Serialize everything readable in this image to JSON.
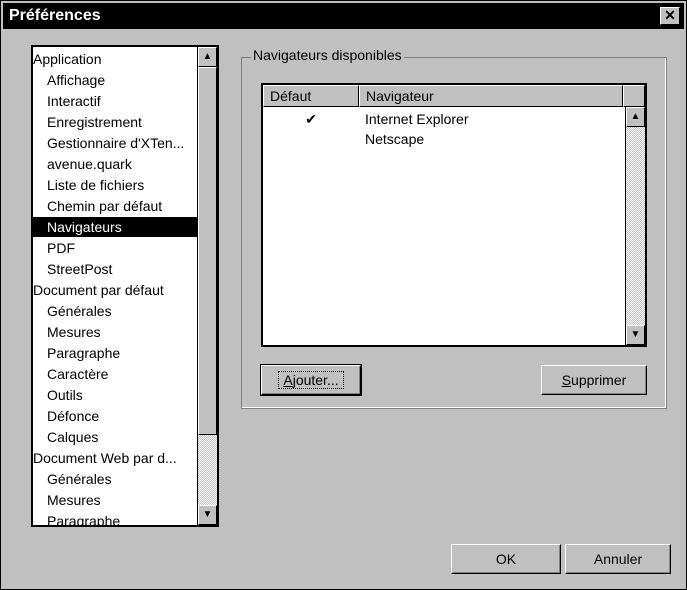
{
  "window": {
    "title": "Préférences"
  },
  "sidebar": {
    "items": [
      {
        "label": "Application",
        "level": 0,
        "selected": false
      },
      {
        "label": "Affichage",
        "level": 1,
        "selected": false
      },
      {
        "label": "Interactif",
        "level": 1,
        "selected": false
      },
      {
        "label": "Enregistrement",
        "level": 1,
        "selected": false
      },
      {
        "label": "Gestionnaire d'XTen...",
        "level": 1,
        "selected": false
      },
      {
        "label": "avenue.quark",
        "level": 1,
        "selected": false
      },
      {
        "label": "Liste de fichiers",
        "level": 1,
        "selected": false
      },
      {
        "label": "Chemin par défaut",
        "level": 1,
        "selected": false
      },
      {
        "label": "Navigateurs",
        "level": 1,
        "selected": true
      },
      {
        "label": "PDF",
        "level": 1,
        "selected": false
      },
      {
        "label": "StreetPost",
        "level": 1,
        "selected": false
      },
      {
        "label": "Document par défaut",
        "level": 0,
        "selected": false
      },
      {
        "label": "Générales",
        "level": 1,
        "selected": false
      },
      {
        "label": "Mesures",
        "level": 1,
        "selected": false
      },
      {
        "label": "Paragraphe",
        "level": 1,
        "selected": false
      },
      {
        "label": "Caractère",
        "level": 1,
        "selected": false
      },
      {
        "label": "Outils",
        "level": 1,
        "selected": false
      },
      {
        "label": "Défonce",
        "level": 1,
        "selected": false
      },
      {
        "label": "Calques",
        "level": 1,
        "selected": false
      },
      {
        "label": "Document Web par d...",
        "level": 0,
        "selected": false
      },
      {
        "label": "Générales",
        "level": 1,
        "selected": false
      },
      {
        "label": "Mesures",
        "level": 1,
        "selected": false
      },
      {
        "label": "Paragraphe",
        "level": 1,
        "selected": false
      }
    ]
  },
  "browsers": {
    "group_label": "Navigateurs disponibles",
    "col_default": "Défaut",
    "col_browser": "Navigateur",
    "rows": [
      {
        "default_mark": "✔",
        "name": "Internet Explorer"
      },
      {
        "default_mark": "",
        "name": "Netscape"
      }
    ],
    "add_label_pre": "",
    "add_label_u": "A",
    "add_label_post": "jouter...",
    "remove_label_u": "S",
    "remove_label_post": "upprimer"
  },
  "footer": {
    "ok_label": "OK",
    "cancel_label": "Annuler"
  }
}
